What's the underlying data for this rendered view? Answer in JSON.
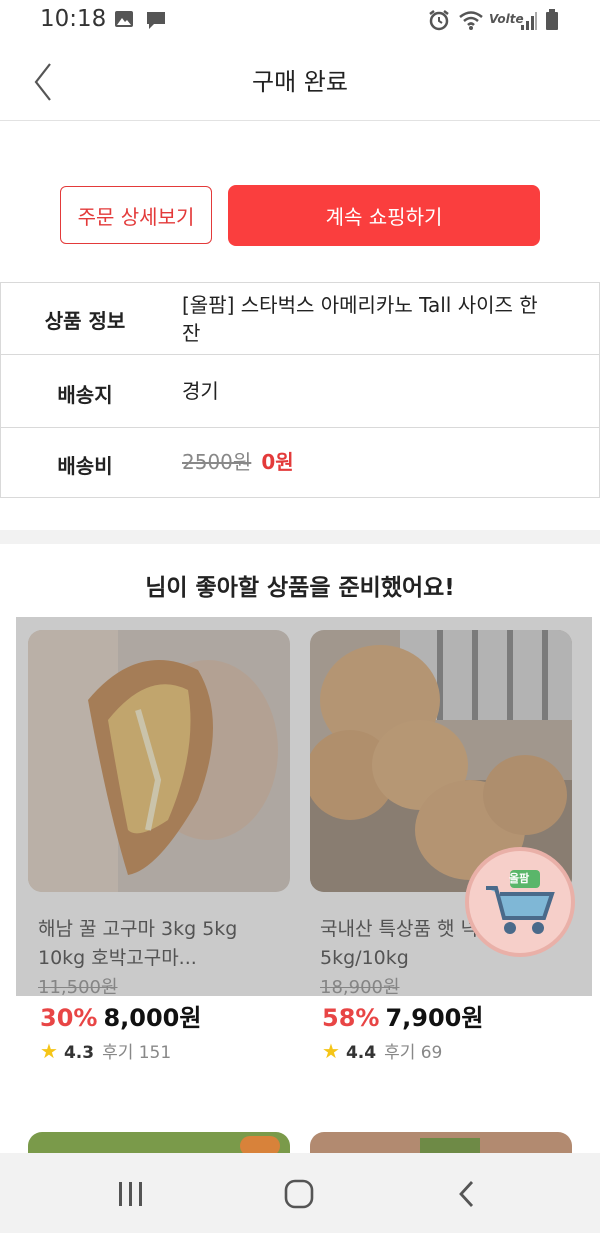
{
  "status_bar": {
    "time": "10:18",
    "carrier": "Volte"
  },
  "header": {
    "title": "구매 완료"
  },
  "buttons": {
    "order_detail": "주문 상세보기",
    "continue_shopping": "계속 쇼핑하기"
  },
  "order_info": [
    {
      "label": "상품 정보",
      "value": "[올팜] 스타벅스 아메리카노 Tall 사이즈 한 잔"
    },
    {
      "label": "배송지",
      "value": "경기"
    },
    {
      "label": "배송비",
      "original": "2500원",
      "value": "0원"
    }
  ],
  "recommend": {
    "title": "님이 좋아할 상품을 준비했어요!",
    "products": [
      {
        "name": "해남 꿀 고구마 3kg 5kg 10kg 호박고구마...",
        "original_price": "11,500원",
        "discount": "30%",
        "price": "8,000원",
        "rating": "4.3",
        "reviews": "후기 151"
      },
      {
        "name": "국내산 특상품 햇 넉넉한 5kg/10kg",
        "original_price": "18,900원",
        "discount": "58%",
        "price": "7,900원",
        "rating": "4.4",
        "reviews": "후기 69"
      }
    ]
  },
  "floating_cart": {
    "label": "올팜"
  },
  "colors": {
    "accent": "#fa3e3e",
    "discount": "#e84545",
    "star": "#f5c518"
  }
}
